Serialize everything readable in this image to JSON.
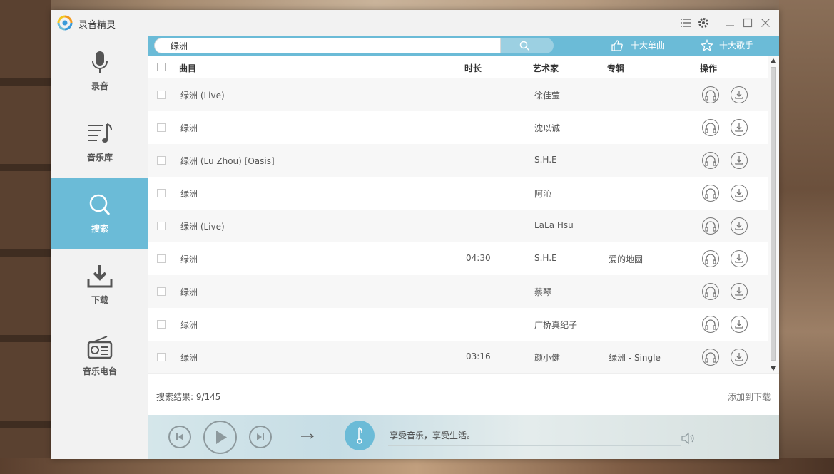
{
  "window": {
    "title": "录音精灵"
  },
  "sidebar": {
    "items": [
      {
        "label": "录音",
        "icon": "microphone-icon",
        "active": false
      },
      {
        "label": "音乐库",
        "icon": "music-list-icon",
        "active": false
      },
      {
        "label": "搜索",
        "icon": "search-icon",
        "active": true
      },
      {
        "label": "下载",
        "icon": "download-icon",
        "active": false
      },
      {
        "label": "音乐电台",
        "icon": "radio-icon",
        "active": false
      }
    ]
  },
  "search": {
    "value": "绿洲",
    "top_singles": "十大单曲",
    "top_singers": "十大歌手"
  },
  "table": {
    "headers": {
      "title": "曲目",
      "duration": "时长",
      "artist": "艺术家",
      "album": "专辑",
      "actions": "操作"
    },
    "rows": [
      {
        "title": "绿洲 (Live)",
        "duration": "",
        "artist": "徐佳莹",
        "album": ""
      },
      {
        "title": "绿洲",
        "duration": "",
        "artist": "沈以诚",
        "album": ""
      },
      {
        "title": "绿洲 (Lu Zhou) [Oasis]",
        "duration": "",
        "artist": "S.H.E",
        "album": ""
      },
      {
        "title": "绿洲",
        "duration": "",
        "artist": "阿沁",
        "album": ""
      },
      {
        "title": "绿洲 (Live)",
        "duration": "",
        "artist": "LaLa Hsu",
        "album": ""
      },
      {
        "title": "绿洲",
        "duration": "04:30",
        "artist": "S.H.E",
        "album": "爱的地圆"
      },
      {
        "title": "绿洲",
        "duration": "",
        "artist": "蔡琴",
        "album": ""
      },
      {
        "title": "绿洲",
        "duration": "",
        "artist": "广桥真纪子",
        "album": ""
      },
      {
        "title": "绿洲",
        "duration": "03:16",
        "artist": "颜小健",
        "album": "绿洲 - Single"
      }
    ]
  },
  "footer": {
    "result_text": "搜索结果: 9/145",
    "add_to_download": "添加到下载"
  },
  "player": {
    "motto": "享受音乐，享受生活。"
  },
  "colors": {
    "accent": "#6bbbd7"
  }
}
